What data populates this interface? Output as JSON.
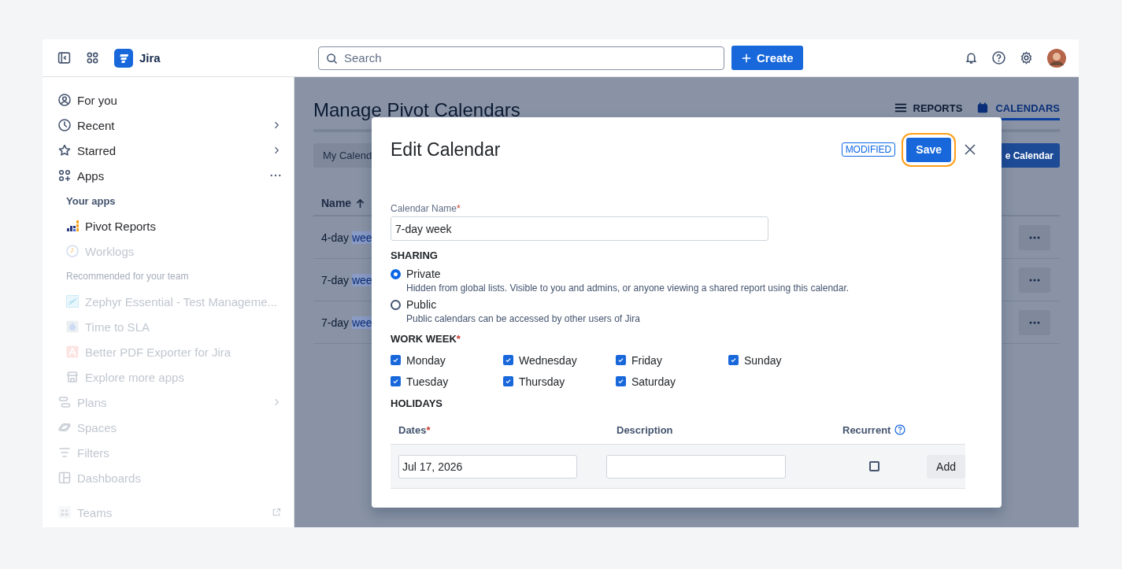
{
  "topbar": {
    "product": "Jira",
    "search": {
      "placeholder": "Search"
    },
    "create_button": "Create"
  },
  "sidebar": {
    "items": [
      {
        "label": "For you",
        "kind": "nav",
        "faded": false,
        "submenu": false,
        "actions": false,
        "external": false
      },
      {
        "label": "Recent",
        "kind": "nav",
        "faded": false,
        "submenu": true,
        "actions": false,
        "external": false
      },
      {
        "label": "Starred",
        "kind": "nav",
        "faded": false,
        "submenu": true,
        "actions": false,
        "external": false
      },
      {
        "label": "Apps",
        "kind": "nav",
        "faded": false,
        "submenu": false,
        "actions": true,
        "external": false
      },
      {
        "label": "Your apps",
        "kind": "heading",
        "faded": false,
        "submenu": false,
        "actions": false,
        "external": false
      },
      {
        "label": "Pivot Reports",
        "kind": "app",
        "faded": false,
        "submenu": false,
        "actions": false,
        "external": false
      },
      {
        "label": "Worklogs",
        "kind": "app",
        "faded": true,
        "submenu": false,
        "actions": false,
        "external": false
      },
      {
        "label": "Recommended for your team",
        "kind": "heading",
        "faded": true,
        "submenu": false,
        "actions": false,
        "external": false
      },
      {
        "label": "Zephyr Essential - Test Manageme...",
        "kind": "app",
        "faded": true,
        "submenu": false,
        "actions": false,
        "external": false
      },
      {
        "label": "Time to SLA",
        "kind": "app",
        "faded": true,
        "submenu": false,
        "actions": false,
        "external": false
      },
      {
        "label": "Better PDF Exporter for Jira",
        "kind": "app",
        "faded": true,
        "submenu": false,
        "actions": false,
        "external": false
      },
      {
        "label": "Explore more apps",
        "kind": "app",
        "faded": true,
        "submenu": false,
        "actions": false,
        "external": false
      },
      {
        "label": "Plans",
        "kind": "nav",
        "faded": true,
        "submenu": true,
        "actions": false,
        "external": false
      },
      {
        "label": "Spaces",
        "kind": "nav",
        "faded": true,
        "submenu": false,
        "actions": false,
        "external": false
      },
      {
        "label": "Filters",
        "kind": "nav",
        "faded": true,
        "submenu": false,
        "actions": false,
        "external": false
      },
      {
        "label": "Dashboards",
        "kind": "nav",
        "faded": true,
        "submenu": false,
        "actions": false,
        "external": false
      },
      {
        "label": "Teams",
        "kind": "nav",
        "faded": true,
        "submenu": false,
        "actions": false,
        "external": true
      }
    ]
  },
  "page": {
    "title": "Manage Pivot Calendars",
    "tabs": [
      {
        "label": "REPORTS",
        "selected": false
      },
      {
        "label": "CALENDARS",
        "selected": true
      }
    ],
    "filter_button": "My Calend",
    "new_button": "e Calendar",
    "table": {
      "columns": [
        "Name"
      ],
      "rows": [
        {
          "prefix": "4-day",
          "highlighted": "wee"
        },
        {
          "prefix": "7-day",
          "highlighted": "wee"
        },
        {
          "prefix": "7-day",
          "highlighted": "wee"
        }
      ]
    }
  },
  "dialog": {
    "title": "Edit Calendar",
    "badge": "MODIFIED",
    "save_button": {
      "label": "Save",
      "focused": true
    },
    "calendar_name": {
      "label": "Calendar Name",
      "required_mark": "*",
      "value": "7-day week"
    },
    "sharing": {
      "heading": "SHARING",
      "options": [
        {
          "label": "Private",
          "description": "Hidden from global lists. Visible to you and admins, or anyone viewing a shared report using this calendar.",
          "selected": true
        },
        {
          "label": "Public",
          "description": "Public calendars can be accessed by other users of Jira",
          "selected": false
        }
      ]
    },
    "work_week": {
      "heading": "WORK WEEK",
      "required_mark": "*",
      "days": [
        {
          "label": "Monday",
          "checked": true
        },
        {
          "label": "Tuesday",
          "checked": true
        },
        {
          "label": "Wednesday",
          "checked": true
        },
        {
          "label": "Thursday",
          "checked": true
        },
        {
          "label": "Friday",
          "checked": true
        },
        {
          "label": "Saturday",
          "checked": true
        },
        {
          "label": "Sunday",
          "checked": true
        }
      ]
    },
    "holidays": {
      "heading": "HOLIDAYS",
      "columns": [
        {
          "label": "Dates",
          "required_mark": "*",
          "help": false
        },
        {
          "label": "Description",
          "help": false
        },
        {
          "label": "Recurrent",
          "help": true
        }
      ],
      "row": {
        "date": "Jul 17, 2026",
        "recurrent": false,
        "add_button": "Add"
      }
    }
  }
}
